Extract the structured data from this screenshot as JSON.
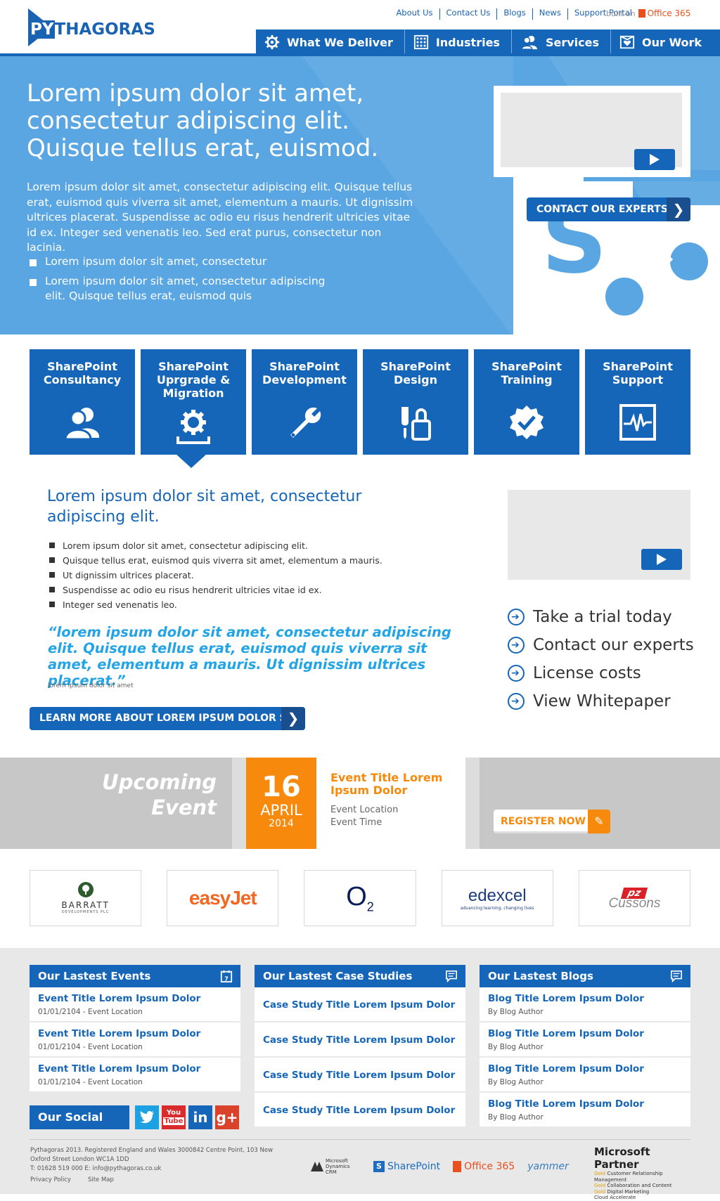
{
  "logo": {
    "text_left": "PY",
    "text_right": "THAGORAS"
  },
  "top_links": [
    "About Us",
    "Contact Us",
    "Blogs",
    "News",
    "Support Portal"
  ],
  "built_on": {
    "label": "built on",
    "brand": "Office 365"
  },
  "nav": [
    {
      "label": "What We Deliver",
      "icon": "gear-icon"
    },
    {
      "label": "Industries",
      "icon": "building-icon"
    },
    {
      "label": "Services",
      "icon": "people-icon"
    },
    {
      "label": "Our Work",
      "icon": "heart-box-icon"
    }
  ],
  "hero": {
    "heading": "Lorem ipsum dolor sit amet, consectetur adipiscing elit. Quisque tellus erat, euismod.",
    "body": "Lorem ipsum dolor sit amet, consectetur adipiscing elit. Quisque tellus erat, euismod quis viverra sit amet, elementum a mauris. Ut dignissim ultrices placerat. Suspendisse ac odio eu risus hendrerit ultricies vitae id ex. Integer sed venenatis leo. Sed erat purus, consectetur non lacinia.",
    "bullets": [
      "Lorem ipsum dolor sit amet, consectetur",
      "Lorem ipsum dolor sit amet, consectetur adipiscing elit. Quisque tellus erat, euismod quis"
    ],
    "cta": "CONTACT OUR EXPERTS"
  },
  "services": [
    {
      "title": "SharePoint Consultancy",
      "icon": "people-icon"
    },
    {
      "title": "SharePoint Uprgrade & Migration",
      "icon": "gear-upload-icon"
    },
    {
      "title": "SharePoint Development",
      "icon": "wrench-icon"
    },
    {
      "title": "SharePoint Design",
      "icon": "brush-bucket-icon"
    },
    {
      "title": "SharePoint Training",
      "icon": "badge-check-icon"
    },
    {
      "title": "SharePoint Support",
      "icon": "heartbeat-icon"
    }
  ],
  "middle": {
    "title": "Lorem ipsum dolor sit amet, consectetur adipiscing elit.",
    "list": [
      "Lorem ipsum dolor sit amet, consectetur adipiscing elit.",
      "Quisque tellus erat, euismod quis viverra sit amet, elementum a mauris.",
      "Ut dignissim ultrices placerat.",
      "Suspendisse ac odio eu risus hendrerit ultricies vitae id ex.",
      "Integer sed venenatis leo."
    ],
    "quote": "“lorem ipsum dolor sit amet, consectetur adipiscing elit. Quisque tellus erat, euismod quis viverra sit amet, elementum a mauris. Ut dignissim ultrices placerat.”",
    "quote_caption": "lorem ipsum dolor sit amet",
    "cta": "LEARN MORE ABOUT LOREM IPSUM DOLOR SI"
  },
  "side_links": [
    "Take a trial today",
    "Contact our experts",
    "License costs",
    "View Whitepaper"
  ],
  "event": {
    "heading_1": "Upcoming",
    "heading_2": "Event",
    "day": "16",
    "month": "APRIL",
    "year": "2014",
    "title": "Event Title Lorem Ipsum Dolor",
    "location": "Event Location",
    "time": "Event Time",
    "register": "REGISTER NOW"
  },
  "clients": [
    "BARRATT",
    "easyJet",
    "O2",
    "edexcel",
    "PZ Cussons"
  ],
  "client_sub": {
    "barratt": "DEVELOPMENTS PLC",
    "edexcel": "advancing learning, changing lives"
  },
  "events_col": {
    "title": "Our Lastest Events",
    "items": [
      {
        "title": "Event Title Lorem Ipsum Dolor",
        "meta": "01/01/2104 - Event Location"
      },
      {
        "title": "Event Title Lorem Ipsum Dolor",
        "meta": "01/01/2104 - Event Location"
      },
      {
        "title": "Event Title Lorem Ipsum Dolor",
        "meta": "01/01/2104 - Event Location"
      }
    ]
  },
  "cases_col": {
    "title": "Our Lastest Case Studies",
    "items": [
      "Case Study Title Lorem Ipsum Dolor",
      "Case Study Title Lorem Ipsum Dolor",
      "Case Study Title Lorem Ipsum Dolor",
      "Case Study Title Lorem Ipsum Dolor"
    ]
  },
  "blogs_col": {
    "title": "Our Lastest Blogs",
    "items": [
      {
        "title": "Blog Title Lorem Ipsum Dolor",
        "meta": "By Blog Author"
      },
      {
        "title": "Blog Title Lorem Ipsum Dolor",
        "meta": "By Blog Author"
      },
      {
        "title": "Blog Title Lorem Ipsum Dolor",
        "meta": "By Blog Author"
      },
      {
        "title": "Blog Title Lorem Ipsum Dolor",
        "meta": "By Blog Author"
      }
    ]
  },
  "social": {
    "title": "Our Social",
    "networks": [
      {
        "name": "twitter-icon",
        "glyph": "t",
        "color": "#1da1e2"
      },
      {
        "name": "youtube-icon",
        "glyph": "You",
        "color": "#d92b2b"
      },
      {
        "name": "linkedin-icon",
        "glyph": "in",
        "color": "#1565b8"
      },
      {
        "name": "googleplus-icon",
        "glyph": "g+",
        "color": "#d9432b"
      }
    ]
  },
  "footer": {
    "address": "Pythagoras 2013. Registered England and Wales 3000842 Centre Point, 103 New Oxford Street London WC1A 1DD",
    "contact": "T: 01628 519 000 E: info@pythagoras.co.uk",
    "links": [
      "Privacy Policy",
      "Site Map"
    ],
    "partners": [
      "Microsoft Dynamics CRM",
      "SharePoint",
      "Office 365",
      "yammer"
    ],
    "ms_partner": {
      "title": "Microsoft Partner",
      "lines": [
        {
          "tier": "Gold",
          "text": "Customer Relationship Management"
        },
        {
          "tier": "Gold",
          "text": "Collaboration and Content"
        },
        {
          "tier": "Gold",
          "text": "Digital Marketing"
        },
        {
          "tier": "",
          "text": "Cloud Accelerate"
        }
      ]
    }
  },
  "colors": {
    "brand_blue": "#1565b8",
    "hero_blue": "#5aa6e2",
    "orange": "#f7890c",
    "quote_cyan": "#22a4e6"
  }
}
